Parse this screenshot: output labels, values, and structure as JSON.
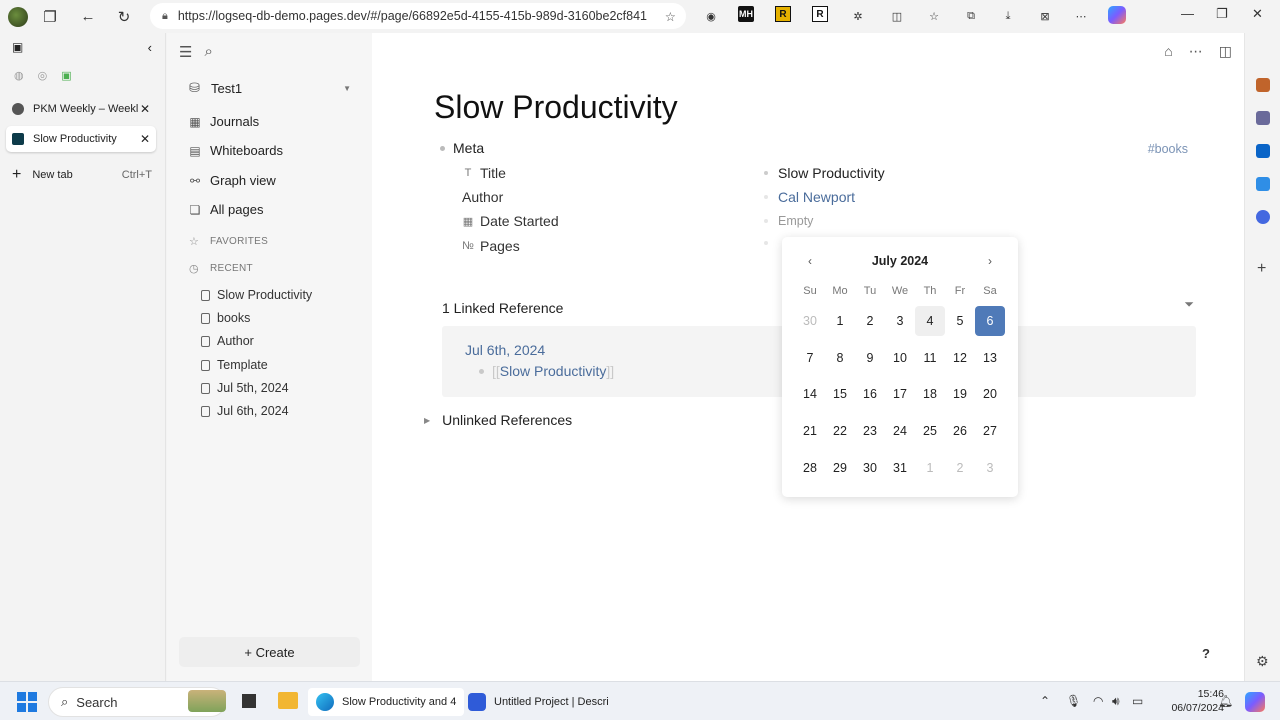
{
  "browser": {
    "url": "https://logseq-db-demo.pages.dev/#/page/66892e5d-4155-415b-989d-3160be2cf841",
    "extension_labels": [
      "MH",
      "R",
      "R"
    ]
  },
  "vertical_tabs": {
    "tabs": [
      {
        "label": "PKM Weekly – Weekly",
        "active": false
      },
      {
        "label": "Slow Productivity",
        "active": true
      }
    ],
    "new_tab_label": "New tab",
    "new_tab_shortcut": "Ctrl+T"
  },
  "sidebar": {
    "graph_name": "Test1",
    "nav": [
      {
        "label": "Journals",
        "icon": "calendar-icon"
      },
      {
        "label": "Whiteboards",
        "icon": "whiteboard-icon"
      },
      {
        "label": "Graph view",
        "icon": "graph-icon"
      },
      {
        "label": "All pages",
        "icon": "pages-icon"
      }
    ],
    "favorites_label": "FAVORITES",
    "recent_label": "RECENT",
    "recent": [
      "Slow Productivity",
      "books",
      "Author",
      "Template",
      "Jul 5th, 2024",
      "Jul 6th, 2024"
    ],
    "create_label": "+ Create"
  },
  "page": {
    "title": "Slow Productivity",
    "meta_label": "Meta",
    "tag": "#books",
    "properties": [
      {
        "key": "Title",
        "icon": "T",
        "value": "Slow Productivity",
        "kind": "text"
      },
      {
        "key": "Author",
        "icon": "",
        "value": "Cal Newport",
        "kind": "link"
      },
      {
        "key": "Date Started",
        "icon": "date-icon",
        "value": "Empty",
        "kind": "empty"
      },
      {
        "key": "Pages",
        "icon": "№",
        "value": "",
        "kind": "empty"
      }
    ],
    "linked_header": "1 Linked Reference",
    "ref_date": "Jul 6th, 2024",
    "ref_open": "[[",
    "ref_link": "Slow Productivity",
    "ref_close": "]]",
    "unlinked_header": "Unlinked References",
    "help_label": "?"
  },
  "datepicker": {
    "month_label": "July 2024",
    "weekdays": [
      "Su",
      "Mo",
      "Tu",
      "We",
      "Th",
      "Fr",
      "Sa"
    ],
    "days": [
      {
        "d": "30",
        "muted": true
      },
      {
        "d": "1"
      },
      {
        "d": "2"
      },
      {
        "d": "3"
      },
      {
        "d": "4",
        "hover": true
      },
      {
        "d": "5"
      },
      {
        "d": "6",
        "selected": true
      },
      {
        "d": "7"
      },
      {
        "d": "8"
      },
      {
        "d": "9"
      },
      {
        "d": "10"
      },
      {
        "d": "11"
      },
      {
        "d": "12"
      },
      {
        "d": "13"
      },
      {
        "d": "14"
      },
      {
        "d": "15"
      },
      {
        "d": "16"
      },
      {
        "d": "17"
      },
      {
        "d": "18"
      },
      {
        "d": "19"
      },
      {
        "d": "20"
      },
      {
        "d": "21"
      },
      {
        "d": "22"
      },
      {
        "d": "23"
      },
      {
        "d": "24"
      },
      {
        "d": "25"
      },
      {
        "d": "26"
      },
      {
        "d": "27"
      },
      {
        "d": "28"
      },
      {
        "d": "29"
      },
      {
        "d": "30"
      },
      {
        "d": "31"
      },
      {
        "d": "1",
        "muted": true
      },
      {
        "d": "2",
        "muted": true
      },
      {
        "d": "3",
        "muted": true
      }
    ]
  },
  "taskbar": {
    "search_label": "Search",
    "apps": [
      {
        "label": "Slow Productivity and 4",
        "active": true
      },
      {
        "label": "Untitled Project | Descri",
        "active": false
      }
    ],
    "time": "15:46",
    "date": "06/07/2024"
  },
  "colors": {
    "accent": "#4f7ab8",
    "link": "#4a6c9b",
    "tag": "#7b93b5"
  }
}
